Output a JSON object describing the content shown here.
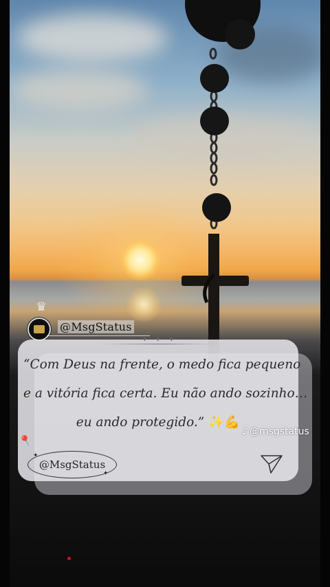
{
  "watermark_top": {
    "handle": "@MsgStatus",
    "crown_icon": "crown-icon"
  },
  "quote": {
    "line1": "“Com Deus na frente, o medo fica pequeno",
    "line2": "e a vitória fica certa. Eu não ando sozinho…",
    "line3": "eu ando protegido.”",
    "emoji": "✨💪"
  },
  "card": {
    "handle": "@MsgStatus",
    "stars": "✦ ✦ ✦",
    "pin_icon": "pin-icon",
    "send_icon": "send-icon"
  },
  "tiktok": {
    "handle": "@msgstatus",
    "icon": "tiktok-icon"
  },
  "colors": {
    "sky_top": "#5f86ac",
    "sun": "#ffe99a",
    "card_bg": "#e8e8ec",
    "text": "#2a2a2a"
  }
}
